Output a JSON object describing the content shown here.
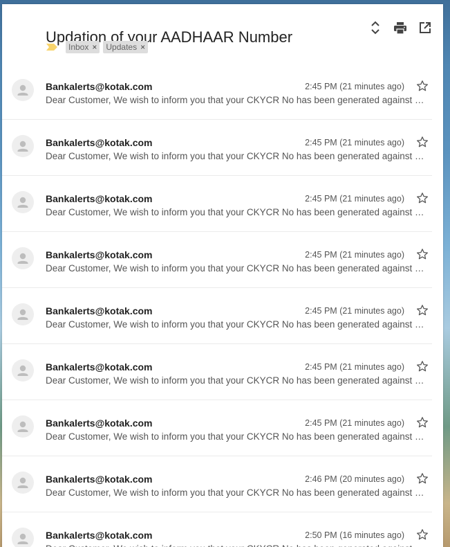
{
  "thread": {
    "subject": "Updation of your AADHAAR Number",
    "labels": [
      "Inbox",
      "Updates"
    ],
    "label_remove_glyph": "×"
  },
  "header_icons": [
    "expand-collapse-icon",
    "print-icon",
    "open-in-new-window-icon"
  ],
  "colors": {
    "importance_marker": "#f8d46c",
    "label_chip_bg": "#dddddd",
    "avatar_bg": "#eeeeee",
    "avatar_fg": "#bdbdbd"
  },
  "messages": [
    {
      "sender": "Bankalerts@kotak.com",
      "time": "2:45 PM (21 minutes ago)",
      "snippet": "Dear Customer, We wish to inform you that your CKYCR No has been generated against CKYCR No. Customer ID"
    },
    {
      "sender": "Bankalerts@kotak.com",
      "time": "2:45 PM (21 minutes ago)",
      "snippet": "Dear Customer, We wish to inform you that your CKYCR No has been generated against CKYCR No. Customer ID"
    },
    {
      "sender": "Bankalerts@kotak.com",
      "time": "2:45 PM (21 minutes ago)",
      "snippet": "Dear Customer, We wish to inform you that your CKYCR No has been generated against CKYCR No. Customer ID"
    },
    {
      "sender": "Bankalerts@kotak.com",
      "time": "2:45 PM (21 minutes ago)",
      "snippet": "Dear Customer, We wish to inform you that your CKYCR No has been generated against CKYCR No. Customer ID"
    },
    {
      "sender": "Bankalerts@kotak.com",
      "time": "2:45 PM (21 minutes ago)",
      "snippet": "Dear Customer, We wish to inform you that your CKYCR No has been generated against CKYCR No. Customer ID"
    },
    {
      "sender": "Bankalerts@kotak.com",
      "time": "2:45 PM (21 minutes ago)",
      "snippet": "Dear Customer, We wish to inform you that your CKYCR No has been generated against CKYCR No. Customer ID"
    },
    {
      "sender": "Bankalerts@kotak.com",
      "time": "2:45 PM (21 minutes ago)",
      "snippet": "Dear Customer, We wish to inform you that your CKYCR No has been generated against CKYCR No. Customer ID"
    },
    {
      "sender": "Bankalerts@kotak.com",
      "time": "2:46 PM (20 minutes ago)",
      "snippet": "Dear Customer, We wish to inform you that your CKYCR No has been generated against CKYCR No. Customer ID"
    },
    {
      "sender": "Bankalerts@kotak.com",
      "time": "2:50 PM (16 minutes ago)",
      "snippet": "Dear Customer, We wish to inform you that your CKYCR No has been generated against CKYCR No. Customer ID"
    }
  ]
}
